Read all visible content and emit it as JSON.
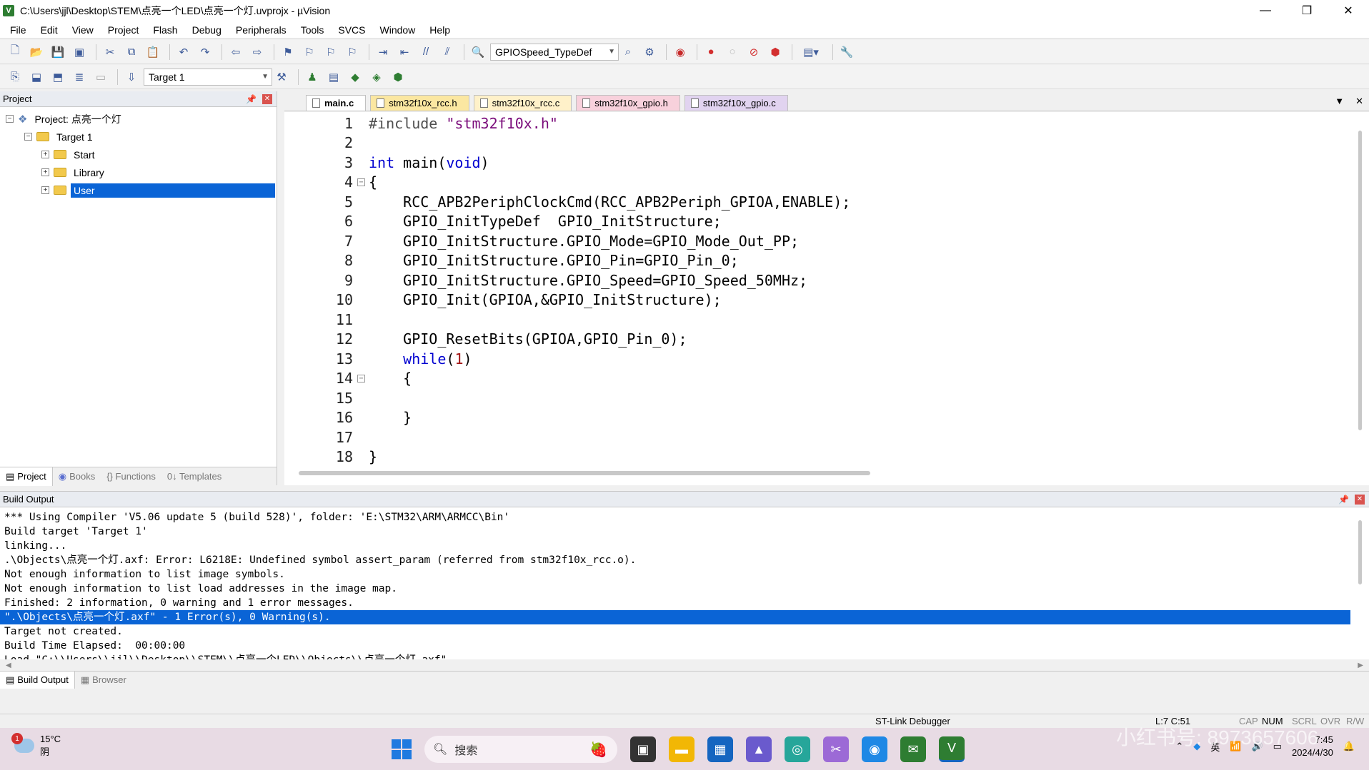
{
  "window": {
    "title": "C:\\Users\\jjl\\Desktop\\STEM\\点亮一个LED\\点亮一个灯.uvprojx - µVision",
    "app_icon": "V",
    "minimize": "—",
    "restore": "❐",
    "close": "✕"
  },
  "menu": [
    "File",
    "Edit",
    "View",
    "Project",
    "Flash",
    "Debug",
    "Peripherals",
    "Tools",
    "SVCS",
    "Window",
    "Help"
  ],
  "toolbar": {
    "find_combo_value": "GPIOSpeed_TypeDef",
    "target_combo_value": "Target 1"
  },
  "project_panel": {
    "title": "Project",
    "root": "Project: 点亮一个灯",
    "target": "Target 1",
    "groups": [
      "Start",
      "Library",
      "User"
    ],
    "selected_group": "User",
    "tabs": [
      "Project",
      "Books",
      "{} Functions",
      "0↓ Templates"
    ]
  },
  "editor": {
    "tabs": [
      "main.c",
      "stm32f10x_rcc.h",
      "stm32f10x_rcc.c",
      "stm32f10x_gpio.h",
      "stm32f10x_gpio.c"
    ],
    "active_tab": "main.c",
    "lines": [
      "#include \"stm32f10x.h\"",
      "",
      "int main(void)",
      "{",
      "    RCC_APB2PeriphClockCmd(RCC_APB2Periph_GPIOA,ENABLE);",
      "    GPIO_InitTypeDef  GPIO_InitStructure;",
      "    GPIO_InitStructure.GPIO_Mode=GPIO_Mode_Out_PP;",
      "    GPIO_InitStructure.GPIO_Pin=GPIO_Pin_0;",
      "    GPIO_InitStructure.GPIO_Speed=GPIO_Speed_50MHz;",
      "    GPIO_Init(GPIOA,&GPIO_InitStructure);",
      "",
      "    GPIO_ResetBits(GPIOA,GPIO_Pin_0);",
      "    while(1)",
      "    {",
      "",
      "    }",
      "",
      "}"
    ]
  },
  "build_output": {
    "title": "Build Output",
    "lines": [
      "*** Using Compiler 'V5.06 update 5 (build 528)', folder: 'E:\\STM32\\ARM\\ARMCC\\Bin'",
      "Build target 'Target 1'",
      "linking...",
      ".\\Objects\\点亮一个灯.axf: Error: L6218E: Undefined symbol assert_param (referred from stm32f10x_rcc.o).",
      "Not enough information to list image symbols.",
      "Not enough information to list load addresses in the image map.",
      "Finished: 2 information, 0 warning and 1 error messages.",
      "\".\\Objects\\点亮一个灯.axf\" - 1 Error(s), 0 Warning(s).",
      "Target not created.",
      "Build Time Elapsed:  00:00:00",
      "Load \"C:\\\\Users\\\\jjl\\\\Desktop\\\\STEM\\\\点亮一个LED\\\\Objects\\\\点亮一个灯.axf\""
    ],
    "highlighted_line": 7,
    "tabs": [
      "Build Output",
      "Browser"
    ]
  },
  "status": {
    "debugger": "ST-Link Debugger",
    "position": "L:7 C:51",
    "cap": "CAP",
    "num": "NUM",
    "scrl": "SCRL",
    "ovr": "OVR",
    "rw": "R/W"
  },
  "taskbar": {
    "weather_temp": "15°C",
    "weather_desc": "阴",
    "weather_badge": "1",
    "search_placeholder": "搜索",
    "ime": "英",
    "time": "7:45",
    "date": "2024/4/30"
  },
  "watermark": "小红书号: 8973657606"
}
